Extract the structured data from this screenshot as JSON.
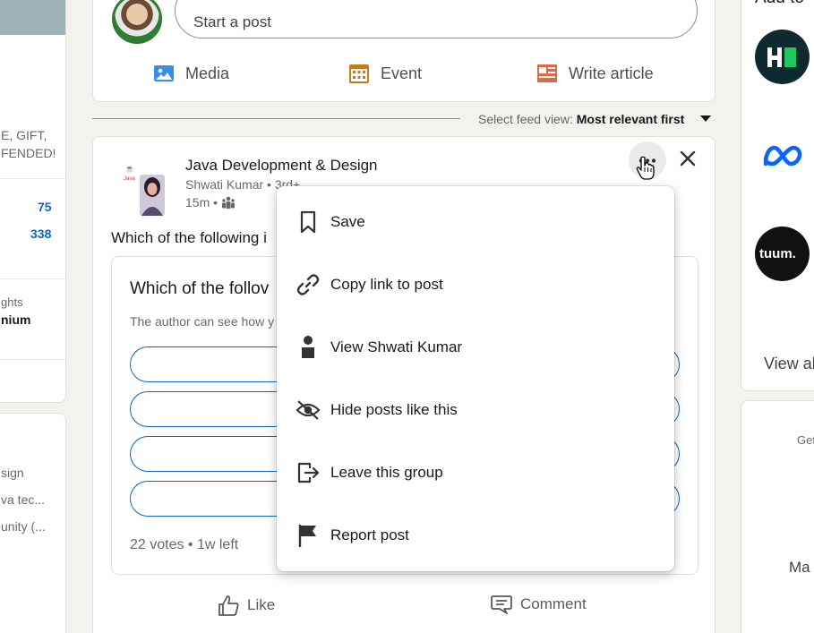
{
  "left_rail": {
    "snippet1": "E, GIFT,",
    "snippet2": "FENDED!",
    "stat1": "75",
    "stat2": "338",
    "insights": "ghts",
    "premium": "nium",
    "group1": "sign",
    "group2": "va tec...",
    "group3": "unity (..."
  },
  "share_box": {
    "placeholder": "Start a post",
    "actions": [
      {
        "label": "Media",
        "icon": "image-icon",
        "color": "#378fe9"
      },
      {
        "label": "Event",
        "icon": "calendar-icon",
        "color": "#c37d16"
      },
      {
        "label": "Write article",
        "icon": "article-icon",
        "color": "#e06847"
      }
    ]
  },
  "feed_sort": {
    "label": "Select feed view:",
    "value": "Most relevant first"
  },
  "post": {
    "group_name": "Java Development & Design",
    "author": "Shwati Kumar • 3rd+",
    "time": "15m •",
    "question": "Which of the following i",
    "poll": {
      "question": "Which of the follov",
      "note": "The author can see how y",
      "options": [
        "",
        "",
        "",
        ""
      ],
      "votes": "22 votes • 1w left"
    },
    "actions": {
      "like": "Like",
      "comment": "Comment"
    }
  },
  "menu": {
    "items": [
      {
        "label": "Save",
        "icon": "bookmark-icon"
      },
      {
        "label": "Copy link to post",
        "icon": "link-icon"
      },
      {
        "label": "View Shwati Kumar",
        "icon": "person-icon"
      },
      {
        "label": "Hide posts like this",
        "icon": "eye-slash-icon"
      },
      {
        "label": "Leave this group",
        "icon": "leave-icon"
      },
      {
        "label": "Report post",
        "icon": "flag-icon"
      }
    ]
  },
  "right_rail": {
    "title": "Add to",
    "view_all": "View al",
    "get_text": "Get",
    "ma_text": "Ma",
    "logos": [
      {
        "name": "H",
        "bg": "#0e2a30"
      },
      {
        "name": "meta",
        "bg": "#ffffff"
      },
      {
        "name": "tuum.",
        "bg": "#111111"
      }
    ]
  },
  "colors": {
    "accent": "#0a66c2",
    "background": "#f4f2ee"
  }
}
